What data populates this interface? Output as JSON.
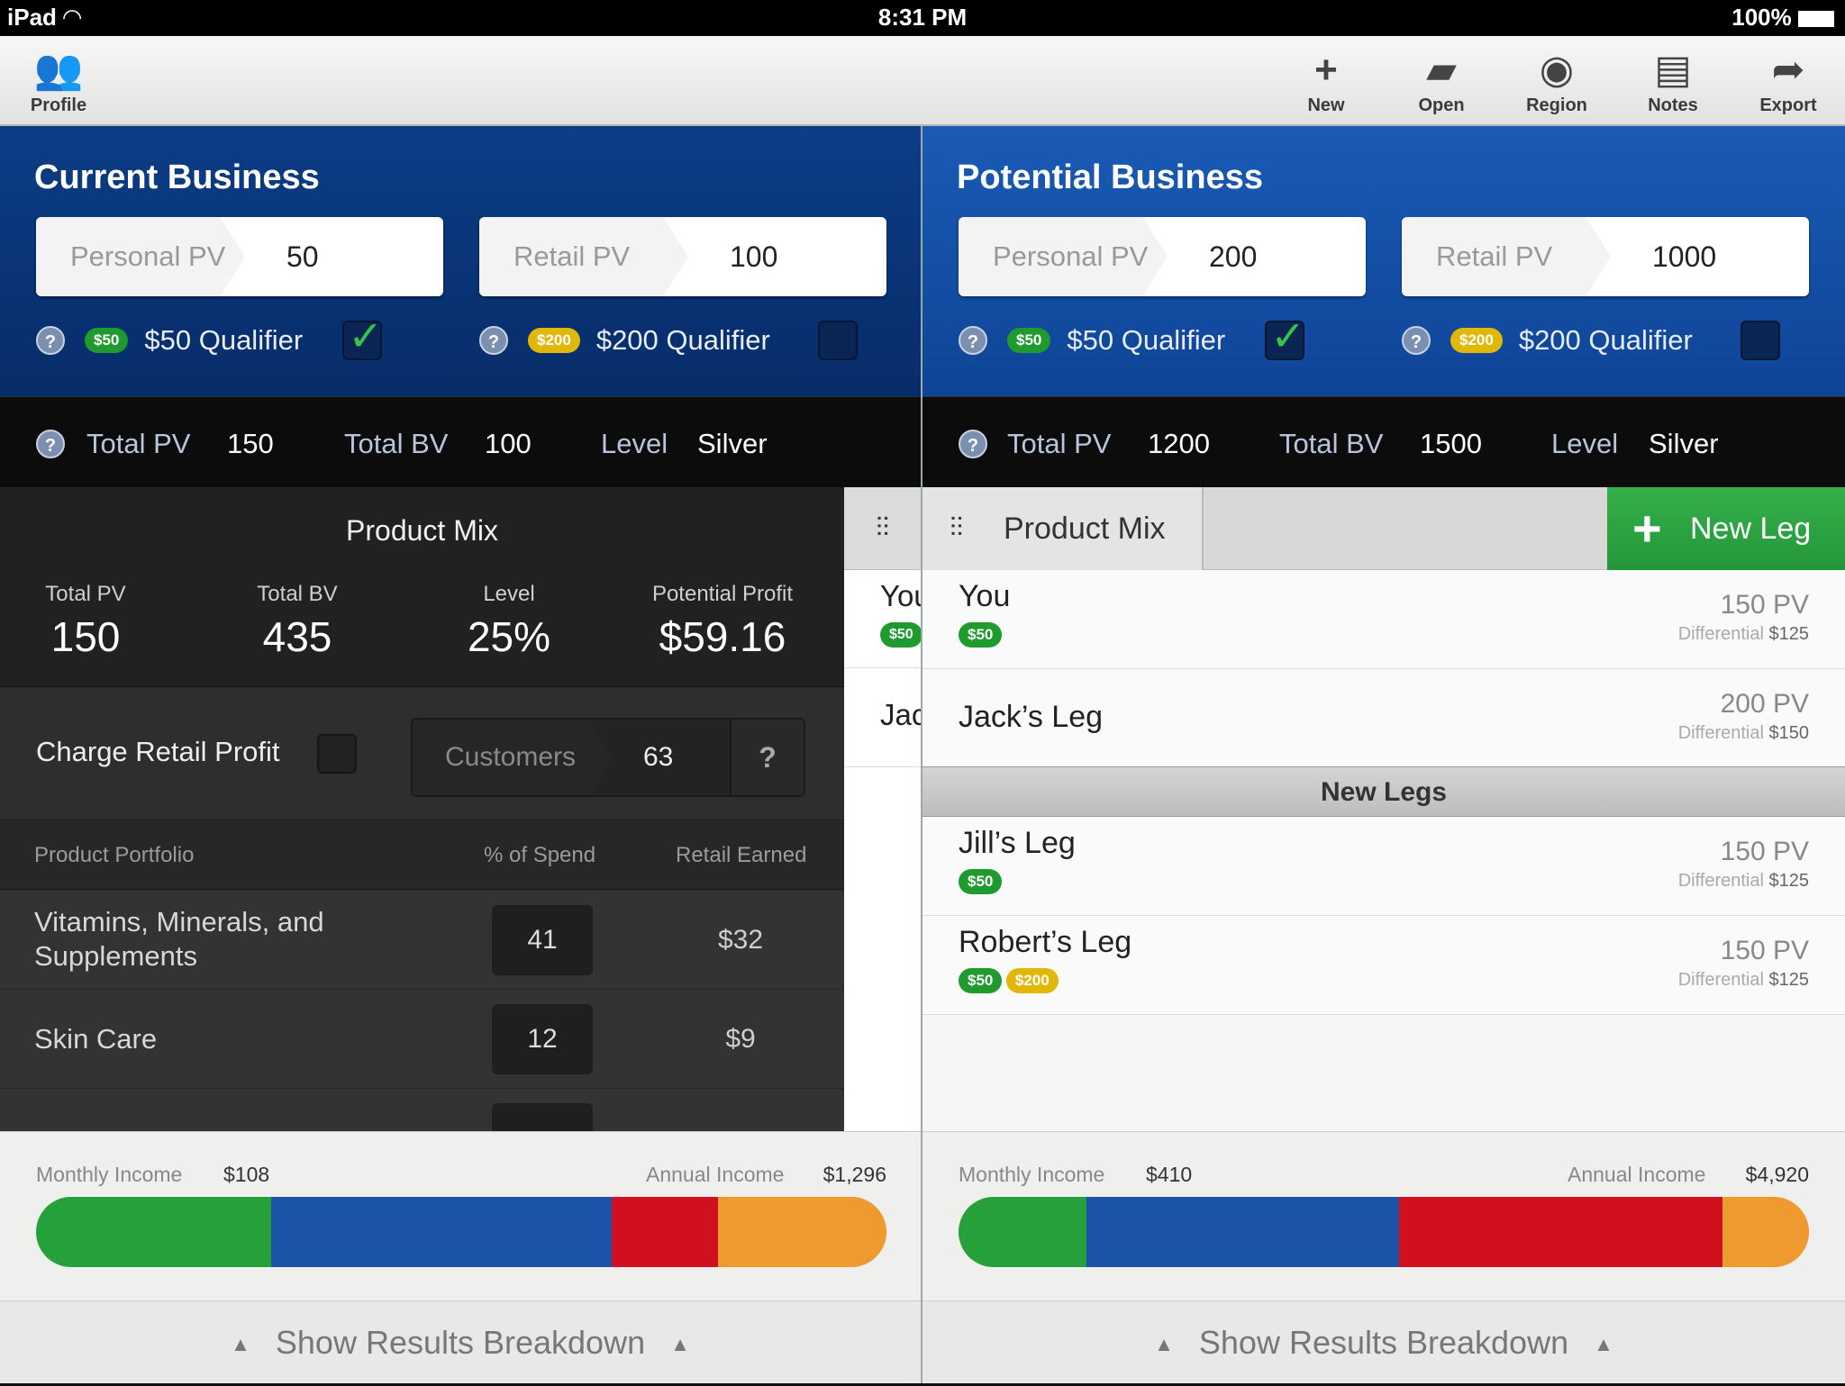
{
  "status": {
    "device": "iPad",
    "time": "8:31 PM",
    "battery": "100%"
  },
  "toolbar": {
    "profile": "Profile",
    "new": "New",
    "open": "Open",
    "region": "Region",
    "notes": "Notes",
    "export": "Export"
  },
  "current": {
    "title": "Current Business",
    "personal_pv_label": "Personal PV",
    "personal_pv": "50",
    "retail_pv_label": "Retail PV",
    "retail_pv": "100",
    "q50_badge": "$50",
    "q50_label": "$50 Qualifier",
    "q50_checked": true,
    "q200_badge": "$200",
    "q200_label": "$200 Qualifier",
    "q200_checked": false,
    "total_pv_label": "Total PV",
    "total_pv": "150",
    "total_bv_label": "Total BV",
    "total_bv": "100",
    "level_label": "Level",
    "level": "Silver"
  },
  "potential": {
    "title": "Potential Business",
    "personal_pv_label": "Personal PV",
    "personal_pv": "200",
    "retail_pv_label": "Retail PV",
    "retail_pv": "1000",
    "q50_badge": "$50",
    "q50_label": "$50 Qualifier",
    "q50_checked": true,
    "q200_badge": "$200",
    "q200_label": "$200 Qualifier",
    "q200_checked": false,
    "total_pv_label": "Total PV",
    "total_pv": "1200",
    "total_bv_label": "Total BV",
    "total_bv": "1500",
    "level_label": "Level",
    "level": "Silver"
  },
  "mix": {
    "title": "Product Mix",
    "stats": [
      {
        "k": "Total PV",
        "v": "150"
      },
      {
        "k": "Total BV",
        "v": "435"
      },
      {
        "k": "Level",
        "v": "25%"
      },
      {
        "k": "Potential Profit",
        "v": "$59.16"
      }
    ],
    "charge_retail": "Charge Retail Profit",
    "customers_label": "Customers",
    "customers": "63",
    "help": "?",
    "headers": {
      "portfolio": "Product Portfolio",
      "spend": "% of Spend",
      "retail": "Retail Earned"
    },
    "rows": [
      {
        "name1": "Vitamins, Minerals, and",
        "name2": "Supplements",
        "spend": "41",
        "retail": "$32"
      },
      {
        "name1": "Skin Care",
        "name2": "",
        "spend": "12",
        "retail": "$9"
      }
    ]
  },
  "peek": {
    "items": [
      "You",
      "Jac"
    ],
    "badge": "$50"
  },
  "legs": {
    "tab": "Product Mix",
    "new_leg": "New Leg",
    "new_legs_header": "New Legs",
    "diff_label": "Differential",
    "existing": [
      {
        "name": "You",
        "pv": "150 PV",
        "diff": "$125",
        "b50": "$50"
      },
      {
        "name": "Jack’s Leg",
        "pv": "200 PV",
        "diff": "$150"
      }
    ],
    "new": [
      {
        "name": "Jill’s Leg",
        "pv": "150 PV",
        "diff": "$125",
        "b50": "$50"
      },
      {
        "name": "Robert’s Leg",
        "pv": "150 PV",
        "diff": "$125",
        "b50": "$50",
        "b200": "$200"
      }
    ]
  },
  "income_left": {
    "monthly_label": "Monthly Income",
    "monthly": "$108",
    "annual_label": "Annual Income",
    "annual": "$1,296",
    "segments": [
      {
        "color": "#25a03a",
        "share": 0.277
      },
      {
        "color": "#1a53a8",
        "share": 0.4
      },
      {
        "color": "#d0101e",
        "share": 0.125
      },
      {
        "color": "#ee9a2e",
        "share": 0.198
      }
    ]
  },
  "income_right": {
    "monthly_label": "Monthly Income",
    "monthly": "$410",
    "annual_label": "Annual Income",
    "annual": "$4,920",
    "segments": [
      {
        "color": "#25a03a",
        "share": 0.15
      },
      {
        "color": "#1a53a8",
        "share": 0.368
      },
      {
        "color": "#d0101e",
        "share": 0.38
      },
      {
        "color": "#ee9a2e",
        "share": 0.102
      }
    ]
  },
  "footer": {
    "label": "Show Results Breakdown"
  }
}
